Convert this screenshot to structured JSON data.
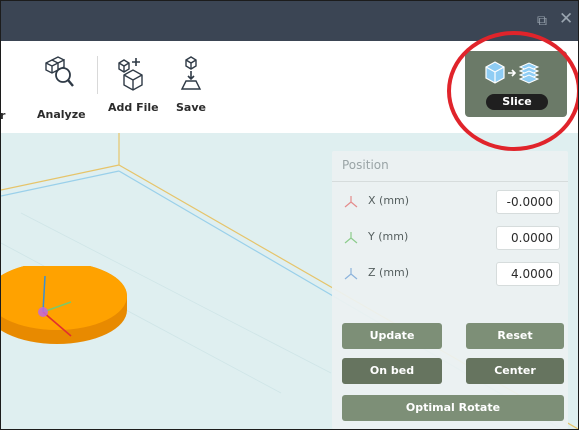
{
  "window": {
    "restore_icon": "restore-icon",
    "close_icon": "close-icon"
  },
  "toolbar": {
    "partial_label": "r",
    "analyze_label": "Analyze",
    "add_file_label": "Add File",
    "save_label": "Save",
    "slice_label": "Slice"
  },
  "position_panel": {
    "title": "Position",
    "rows": [
      {
        "label": "X (mm)",
        "value": "-0.0000"
      },
      {
        "label": "Y (mm)",
        "value": "0.0000"
      },
      {
        "label": "Z (mm)",
        "value": "4.0000"
      }
    ],
    "buttons": {
      "update": "Update",
      "reset": "Reset",
      "on_bed": "On bed",
      "center": "Center",
      "optimal_rotate": "Optimal Rotate"
    }
  },
  "colors": {
    "title_bar": "#3b4554",
    "accent_green": "#6b7a68",
    "highlight_ring": "#e0242b",
    "model_orange": "#ff9a00",
    "viewport_bg": "#dfeff0"
  }
}
